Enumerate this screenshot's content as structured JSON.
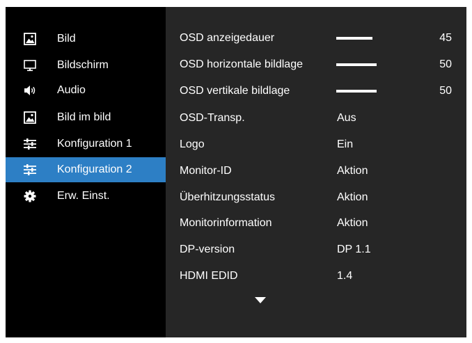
{
  "sidebar": {
    "items": [
      {
        "label": "Bild",
        "icon": "picture-icon"
      },
      {
        "label": "Bildschirm",
        "icon": "monitor-icon"
      },
      {
        "label": "Audio",
        "icon": "speaker-icon"
      },
      {
        "label": "Bild im bild",
        "icon": "picture-in-picture-icon"
      },
      {
        "label": "Konfiguration 1",
        "icon": "sliders-icon"
      },
      {
        "label": "Konfiguration 2",
        "icon": "sliders-icon",
        "selected": true
      },
      {
        "label": "Erw. Einst.",
        "icon": "gear-icon"
      }
    ]
  },
  "settings": {
    "rows": [
      {
        "name": "OSD anzeigedauer",
        "value": "45",
        "level": 0.45
      },
      {
        "name": "OSD horizontale bildlage",
        "value": "50",
        "level": 0.5
      },
      {
        "name": "OSD vertikale bildlage",
        "value": "50",
        "level": 0.5
      },
      {
        "name": "OSD-Transp.",
        "value": "Aus"
      },
      {
        "name": "Logo",
        "value": "Ein"
      },
      {
        "name": "Monitor-ID",
        "value": "Aktion"
      },
      {
        "name": "Überhitzungsstatus",
        "value": "Aktion"
      },
      {
        "name": "Monitorinformation",
        "value": "Aktion"
      },
      {
        "name": "DP-version",
        "value": "DP 1.1"
      },
      {
        "name": "HDMI EDID",
        "value": "1.4"
      }
    ]
  },
  "scroll": {
    "icon": "chevron-down-icon"
  },
  "colors": {
    "sidebar_background": "#000000",
    "content_background": "#262626",
    "selected_item": "#2d7fc5",
    "text": "#ffffff"
  }
}
